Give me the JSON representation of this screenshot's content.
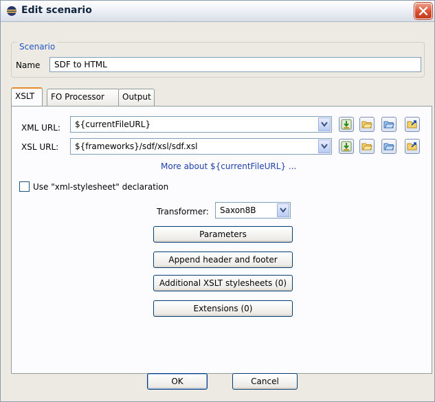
{
  "window": {
    "title": "Edit scenario"
  },
  "scenario": {
    "legend": "Scenario",
    "name_label": "Name",
    "name_value": "SDF to HTML"
  },
  "tabs": [
    {
      "label": "XSLT"
    },
    {
      "label": "FO Processor"
    },
    {
      "label": "Output"
    }
  ],
  "xslt": {
    "xml_url_label": "XML URL:",
    "xml_url_value": "${currentFileURL}",
    "xsl_url_label": "XSL URL:",
    "xsl_url_value": "${frameworks}/sdf/xsl/sdf.xsl",
    "more_link": "More about ${currentFileURL} ...",
    "use_stylesheet_label": "Use \"xml-stylesheet\" declaration",
    "use_stylesheet_checked": false,
    "transformer_label": "Transformer:",
    "transformer_value": "Saxon8B",
    "buttons": {
      "parameters": "Parameters",
      "append": "Append header and footer",
      "additional": "Additional XSLT stylesheets (0)",
      "extensions": "Extensions (0)"
    }
  },
  "footer": {
    "ok": "OK",
    "cancel": "Cancel"
  },
  "colors": {
    "accent_tab": "#e68b2c",
    "link": "#1d3fa8",
    "legend": "#2255c4",
    "close": "#d9502f"
  },
  "icons": [
    "app-icon",
    "close-icon",
    "insert-editor-variables-icon",
    "browse-folder-icon",
    "browse-ftp-icon",
    "open-in-editor-icon",
    "chevron-down-icon"
  ]
}
